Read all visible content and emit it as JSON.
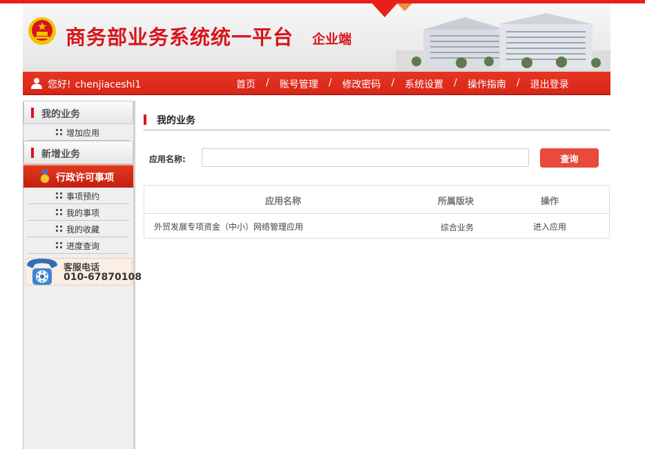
{
  "header": {
    "title": "商务部业务系统统一平台",
    "subtitle": "企业端"
  },
  "navbar": {
    "greeting": "您好!",
    "username": "chenjiaceshi1",
    "separator": "/",
    "links": [
      "首页",
      "账号管理",
      "修改密码",
      "系统设置",
      "操作指南",
      "退出登录"
    ]
  },
  "sidebar": {
    "section_my": "我的业务",
    "my_items": [
      "增加应用"
    ],
    "section_new": "新增业务",
    "active_item": "行政许可事项",
    "sub_items": [
      "事项预约",
      "我的事项",
      "我的收藏",
      "进度查询"
    ],
    "hotline_label": "客服电话",
    "hotline_number": "010-67870108"
  },
  "main": {
    "title": "我的业务",
    "search_label": "应用名称:",
    "search_value": "",
    "search_button": "查询",
    "table": {
      "headers": [
        "应用名称",
        "所属版块",
        "操作"
      ],
      "rows": [
        [
          "外贸发展专项资金（中小）网络管理应用",
          "综合业务",
          "进入应用"
        ]
      ]
    }
  },
  "colors": {
    "brand_red": "#d7141c",
    "nav_red": "#e63522",
    "button_red": "#e84a3c"
  },
  "icons": [
    "national-emblem-icon",
    "user-icon",
    "drag-dots-icon",
    "medal-icon",
    "telephone-icon"
  ]
}
